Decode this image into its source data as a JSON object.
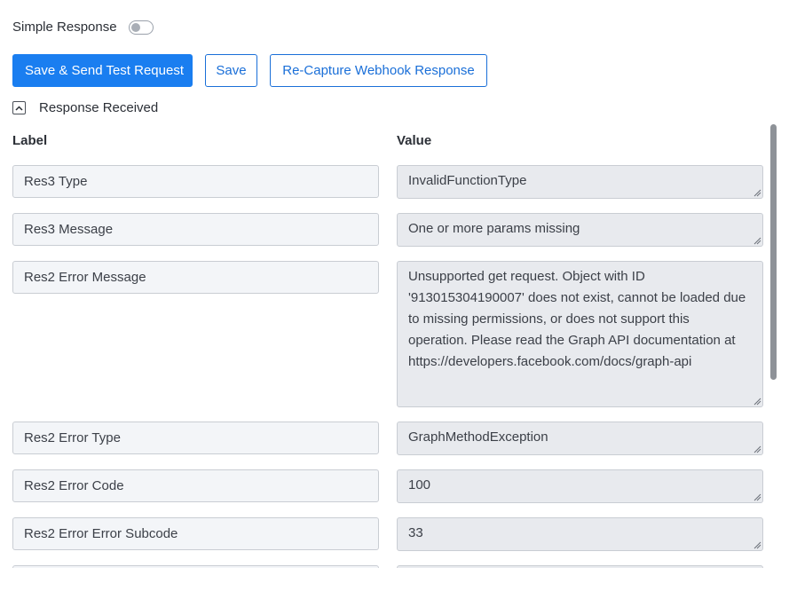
{
  "simple_response": {
    "label": "Simple Response",
    "enabled": false
  },
  "buttons": {
    "save_send": "Save & Send Test Request",
    "save": "Save",
    "recapture": "Re-Capture Webhook Response"
  },
  "response_section": {
    "label": "Response Received",
    "expanded": true
  },
  "columns": {
    "label": "Label",
    "value": "Value"
  },
  "rows": [
    {
      "label": "Res3 Type",
      "value": "InvalidFunctionType"
    },
    {
      "label": "Res3 Message",
      "value": "One or more params missing"
    },
    {
      "label": "Res2 Error Message",
      "value": "Unsupported get request. Object with ID '913015304190007' does not exist, cannot be loaded due to missing permissions, or does not support this operation. Please read the Graph API documentation at https://developers.facebook.com/docs/graph-api"
    },
    {
      "label": "Res2 Error Type",
      "value": "GraphMethodException"
    },
    {
      "label": "Res2 Error Code",
      "value": "100"
    },
    {
      "label": "Res2 Error Error Subcode",
      "value": "33"
    },
    {
      "label": "",
      "value": ""
    }
  ],
  "colors": {
    "primary": "#1a7ef0",
    "outline": "#1a6fd8",
    "label_bg": "#f3f5f8",
    "value_bg": "#e8eaee"
  }
}
